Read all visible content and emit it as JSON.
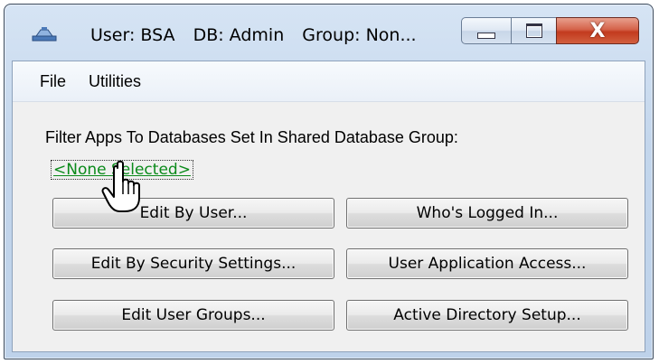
{
  "window": {
    "title_user": "User: BSA",
    "title_db": "DB: Admin",
    "title_group": "Group: Non..."
  },
  "caption_buttons": {
    "close_glyph": "X"
  },
  "menu": {
    "file": "File",
    "utilities": "Utilities"
  },
  "filter": {
    "label": "Filter Apps To Databases Set In Shared Database Group:",
    "link": "<None Selected>"
  },
  "buttons": {
    "edit_by_user": "Edit By User...",
    "whos_logged_in": "Who's Logged In...",
    "edit_by_security": "Edit By Security Settings...",
    "user_app_access": "User Application Access...",
    "edit_user_groups": "Edit User Groups...",
    "active_directory": "Active Directory Setup..."
  },
  "colors": {
    "link": "#0a8a1a",
    "close_button": "#c23a1e"
  }
}
